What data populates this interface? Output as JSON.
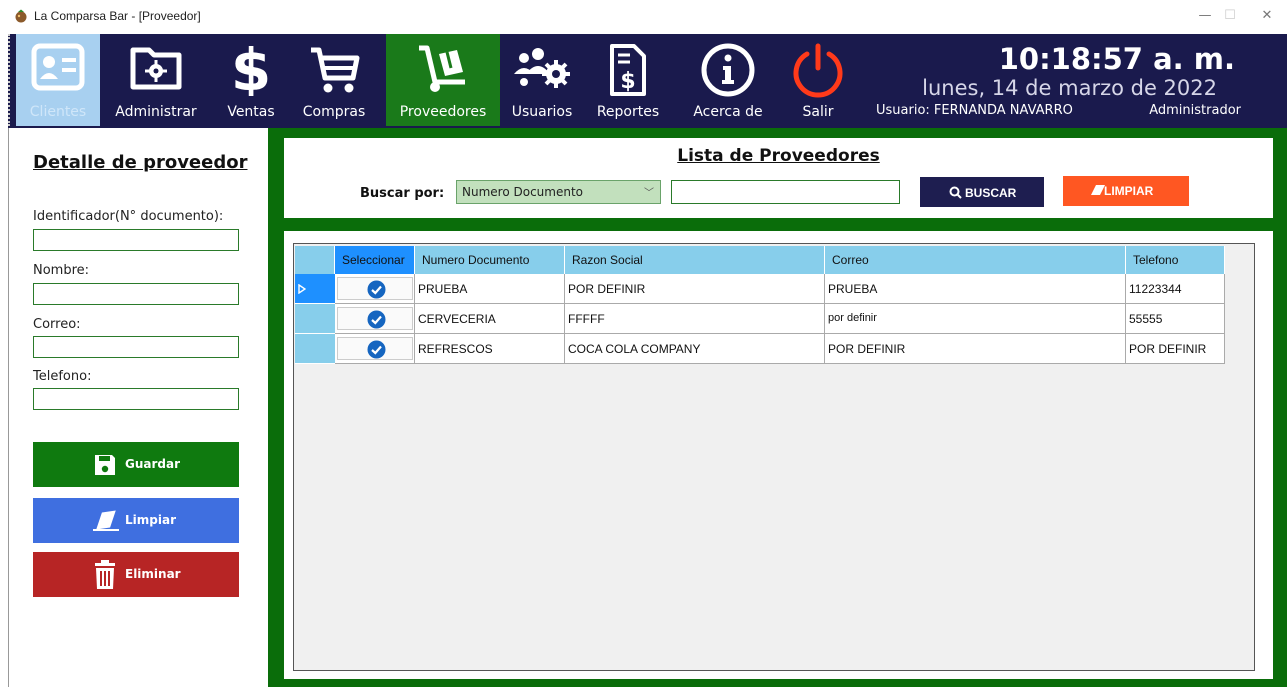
{
  "window": {
    "title": "La Comparsa Bar - [Proveedor]",
    "minimize_glyph": "—",
    "maximize_glyph": "☐",
    "close_glyph": "✕"
  },
  "menu": {
    "items": [
      {
        "label": "Clientes",
        "icon": "id-card-icon"
      },
      {
        "label": "Administrar",
        "icon": "folder-gear-icon"
      },
      {
        "label": "Ventas",
        "icon": "dollar-icon"
      },
      {
        "label": "Compras",
        "icon": "cart-icon"
      },
      {
        "label": "Proveedores",
        "icon": "hand-truck-icon"
      },
      {
        "label": "Usuarios",
        "icon": "users-gear-icon"
      },
      {
        "label": "Reportes",
        "icon": "report-dollar-icon"
      },
      {
        "label": "Acerca de",
        "icon": "info-icon"
      },
      {
        "label": "Salir",
        "icon": "power-icon"
      }
    ],
    "clock": "10:18:57 a. m.",
    "date": "lunes, 14 de marzo de 2022",
    "user": "Usuario: FERNANDA NAVARRO",
    "role": "Administrador"
  },
  "detail": {
    "title": "Detalle de proveedor",
    "fields": [
      {
        "label": "Identificador(N° documento):",
        "value": ""
      },
      {
        "label": "Nombre:",
        "value": ""
      },
      {
        "label": "Correo:",
        "value": ""
      },
      {
        "label": "Telefono:",
        "value": ""
      }
    ],
    "buttons": {
      "save": "Guardar",
      "clear": "Limpiar",
      "delete": "Eliminar"
    }
  },
  "list": {
    "title": "Lista de Proveedores",
    "search_label": "Buscar por:",
    "search_option": "Numero Documento",
    "search_value": "",
    "search_button": "BUSCAR",
    "clear_button": "LIMPIAR",
    "columns": [
      "Seleccionar",
      "Numero Documento",
      "Razon Social",
      "Correo",
      "Telefono"
    ],
    "rows": [
      {
        "numero": "PRUEBA",
        "razon": "POR DEFINIR",
        "correo": "PRUEBA",
        "telefono": "11223344"
      },
      {
        "numero": "CERVECERIA",
        "razon": "FFFFF",
        "correo": "por definir",
        "telefono": "55555"
      },
      {
        "numero": "REFRESCOS",
        "razon": "COCA COLA COMPANY",
        "correo": "POR DEFINIR",
        "telefono": "POR DEFINIR"
      }
    ]
  },
  "colors": {
    "menu_bg": "#1a1a4d",
    "active_green": "#1a7a1a",
    "frame_green": "#0a6d0a",
    "save_green": "#0f7a0f",
    "clear_blue": "#3f6fe0",
    "delete_red": "#b72525",
    "orange": "#ff5722",
    "header_blue": "#87ceeb"
  }
}
